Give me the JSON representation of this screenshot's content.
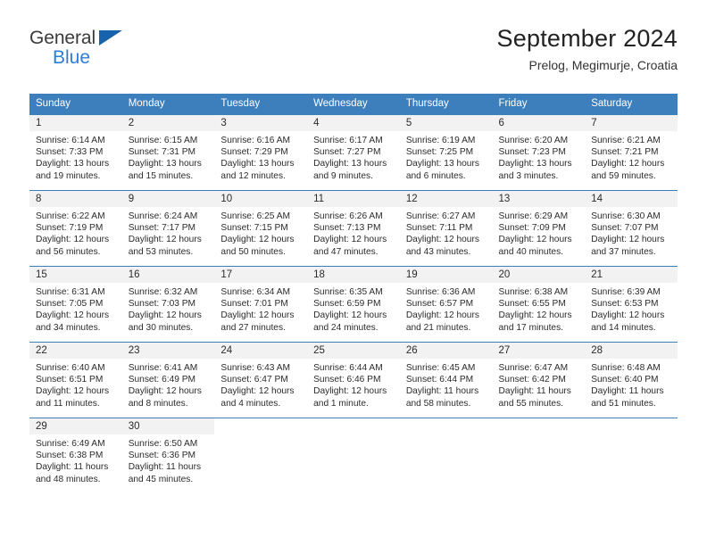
{
  "brand": {
    "name_top": "General",
    "name_bottom": "Blue"
  },
  "header": {
    "title": "September 2024",
    "subtitle": "Prelog, Megimurje, Croatia"
  },
  "calendar": {
    "weekdays": [
      "Sunday",
      "Monday",
      "Tuesday",
      "Wednesday",
      "Thursday",
      "Friday",
      "Saturday"
    ],
    "accent_color": "#3d7ebd",
    "daynum_band_color": "#f2f2f2",
    "weeks": [
      [
        {
          "day": "1",
          "sunrise": "Sunrise: 6:14 AM",
          "sunset": "Sunset: 7:33 PM",
          "daylight": "Daylight: 13 hours and 19 minutes."
        },
        {
          "day": "2",
          "sunrise": "Sunrise: 6:15 AM",
          "sunset": "Sunset: 7:31 PM",
          "daylight": "Daylight: 13 hours and 15 minutes."
        },
        {
          "day": "3",
          "sunrise": "Sunrise: 6:16 AM",
          "sunset": "Sunset: 7:29 PM",
          "daylight": "Daylight: 13 hours and 12 minutes."
        },
        {
          "day": "4",
          "sunrise": "Sunrise: 6:17 AM",
          "sunset": "Sunset: 7:27 PM",
          "daylight": "Daylight: 13 hours and 9 minutes."
        },
        {
          "day": "5",
          "sunrise": "Sunrise: 6:19 AM",
          "sunset": "Sunset: 7:25 PM",
          "daylight": "Daylight: 13 hours and 6 minutes."
        },
        {
          "day": "6",
          "sunrise": "Sunrise: 6:20 AM",
          "sunset": "Sunset: 7:23 PM",
          "daylight": "Daylight: 13 hours and 3 minutes."
        },
        {
          "day": "7",
          "sunrise": "Sunrise: 6:21 AM",
          "sunset": "Sunset: 7:21 PM",
          "daylight": "Daylight: 12 hours and 59 minutes."
        }
      ],
      [
        {
          "day": "8",
          "sunrise": "Sunrise: 6:22 AM",
          "sunset": "Sunset: 7:19 PM",
          "daylight": "Daylight: 12 hours and 56 minutes."
        },
        {
          "day": "9",
          "sunrise": "Sunrise: 6:24 AM",
          "sunset": "Sunset: 7:17 PM",
          "daylight": "Daylight: 12 hours and 53 minutes."
        },
        {
          "day": "10",
          "sunrise": "Sunrise: 6:25 AM",
          "sunset": "Sunset: 7:15 PM",
          "daylight": "Daylight: 12 hours and 50 minutes."
        },
        {
          "day": "11",
          "sunrise": "Sunrise: 6:26 AM",
          "sunset": "Sunset: 7:13 PM",
          "daylight": "Daylight: 12 hours and 47 minutes."
        },
        {
          "day": "12",
          "sunrise": "Sunrise: 6:27 AM",
          "sunset": "Sunset: 7:11 PM",
          "daylight": "Daylight: 12 hours and 43 minutes."
        },
        {
          "day": "13",
          "sunrise": "Sunrise: 6:29 AM",
          "sunset": "Sunset: 7:09 PM",
          "daylight": "Daylight: 12 hours and 40 minutes."
        },
        {
          "day": "14",
          "sunrise": "Sunrise: 6:30 AM",
          "sunset": "Sunset: 7:07 PM",
          "daylight": "Daylight: 12 hours and 37 minutes."
        }
      ],
      [
        {
          "day": "15",
          "sunrise": "Sunrise: 6:31 AM",
          "sunset": "Sunset: 7:05 PM",
          "daylight": "Daylight: 12 hours and 34 minutes."
        },
        {
          "day": "16",
          "sunrise": "Sunrise: 6:32 AM",
          "sunset": "Sunset: 7:03 PM",
          "daylight": "Daylight: 12 hours and 30 minutes."
        },
        {
          "day": "17",
          "sunrise": "Sunrise: 6:34 AM",
          "sunset": "Sunset: 7:01 PM",
          "daylight": "Daylight: 12 hours and 27 minutes."
        },
        {
          "day": "18",
          "sunrise": "Sunrise: 6:35 AM",
          "sunset": "Sunset: 6:59 PM",
          "daylight": "Daylight: 12 hours and 24 minutes."
        },
        {
          "day": "19",
          "sunrise": "Sunrise: 6:36 AM",
          "sunset": "Sunset: 6:57 PM",
          "daylight": "Daylight: 12 hours and 21 minutes."
        },
        {
          "day": "20",
          "sunrise": "Sunrise: 6:38 AM",
          "sunset": "Sunset: 6:55 PM",
          "daylight": "Daylight: 12 hours and 17 minutes."
        },
        {
          "day": "21",
          "sunrise": "Sunrise: 6:39 AM",
          "sunset": "Sunset: 6:53 PM",
          "daylight": "Daylight: 12 hours and 14 minutes."
        }
      ],
      [
        {
          "day": "22",
          "sunrise": "Sunrise: 6:40 AM",
          "sunset": "Sunset: 6:51 PM",
          "daylight": "Daylight: 12 hours and 11 minutes."
        },
        {
          "day": "23",
          "sunrise": "Sunrise: 6:41 AM",
          "sunset": "Sunset: 6:49 PM",
          "daylight": "Daylight: 12 hours and 8 minutes."
        },
        {
          "day": "24",
          "sunrise": "Sunrise: 6:43 AM",
          "sunset": "Sunset: 6:47 PM",
          "daylight": "Daylight: 12 hours and 4 minutes."
        },
        {
          "day": "25",
          "sunrise": "Sunrise: 6:44 AM",
          "sunset": "Sunset: 6:46 PM",
          "daylight": "Daylight: 12 hours and 1 minute."
        },
        {
          "day": "26",
          "sunrise": "Sunrise: 6:45 AM",
          "sunset": "Sunset: 6:44 PM",
          "daylight": "Daylight: 11 hours and 58 minutes."
        },
        {
          "day": "27",
          "sunrise": "Sunrise: 6:47 AM",
          "sunset": "Sunset: 6:42 PM",
          "daylight": "Daylight: 11 hours and 55 minutes."
        },
        {
          "day": "28",
          "sunrise": "Sunrise: 6:48 AM",
          "sunset": "Sunset: 6:40 PM",
          "daylight": "Daylight: 11 hours and 51 minutes."
        }
      ],
      [
        {
          "day": "29",
          "sunrise": "Sunrise: 6:49 AM",
          "sunset": "Sunset: 6:38 PM",
          "daylight": "Daylight: 11 hours and 48 minutes."
        },
        {
          "day": "30",
          "sunrise": "Sunrise: 6:50 AM",
          "sunset": "Sunset: 6:36 PM",
          "daylight": "Daylight: 11 hours and 45 minutes."
        },
        {
          "day": "",
          "sunrise": "",
          "sunset": "",
          "daylight": ""
        },
        {
          "day": "",
          "sunrise": "",
          "sunset": "",
          "daylight": ""
        },
        {
          "day": "",
          "sunrise": "",
          "sunset": "",
          "daylight": ""
        },
        {
          "day": "",
          "sunrise": "",
          "sunset": "",
          "daylight": ""
        },
        {
          "day": "",
          "sunrise": "",
          "sunset": "",
          "daylight": ""
        }
      ]
    ]
  }
}
